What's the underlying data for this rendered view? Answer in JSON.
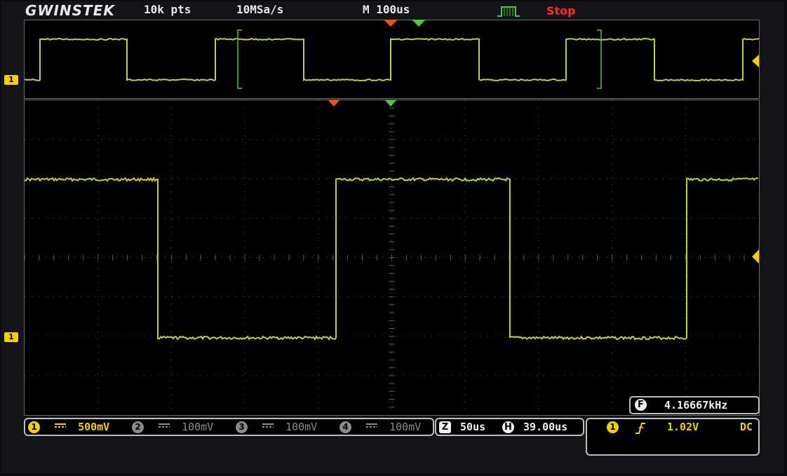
{
  "header": {
    "brand": "GWINSTEK",
    "record_length": "10k pts",
    "sample_rate": "10MSa/s",
    "timebase": "M 100us",
    "run_status": "Stop"
  },
  "channels": [
    {
      "id": "1",
      "coupling_symbol": "dc",
      "scale": "500mV",
      "active": true,
      "color": "#f0d000"
    },
    {
      "id": "2",
      "coupling_symbol": "dc",
      "scale": "100mV",
      "active": false,
      "color": "#8a8a8a"
    },
    {
      "id": "3",
      "coupling_symbol": "dc",
      "scale": "100mV",
      "active": false,
      "color": "#8a8a8a"
    },
    {
      "id": "4",
      "coupling_symbol": "dc",
      "scale": "100mV",
      "active": false,
      "color": "#8a8a8a"
    }
  ],
  "zoom": {
    "icon": "Z",
    "value": "50us"
  },
  "horizontal": {
    "icon": "H",
    "value": "39.00us"
  },
  "trigger": {
    "source": "1",
    "slope_icon": "rising-edge-icon",
    "level": "1.02V",
    "coupling": "DC"
  },
  "frequency": {
    "icon": "F",
    "value": "4.16667kHz"
  },
  "channel_marker_label": "1",
  "colors": {
    "trace": "#c8cc3a",
    "grid": "#5a5a5a",
    "trigger_marker": "#ff4a1a",
    "position_marker": "#4ec83a",
    "channel": "#f0d000"
  }
}
